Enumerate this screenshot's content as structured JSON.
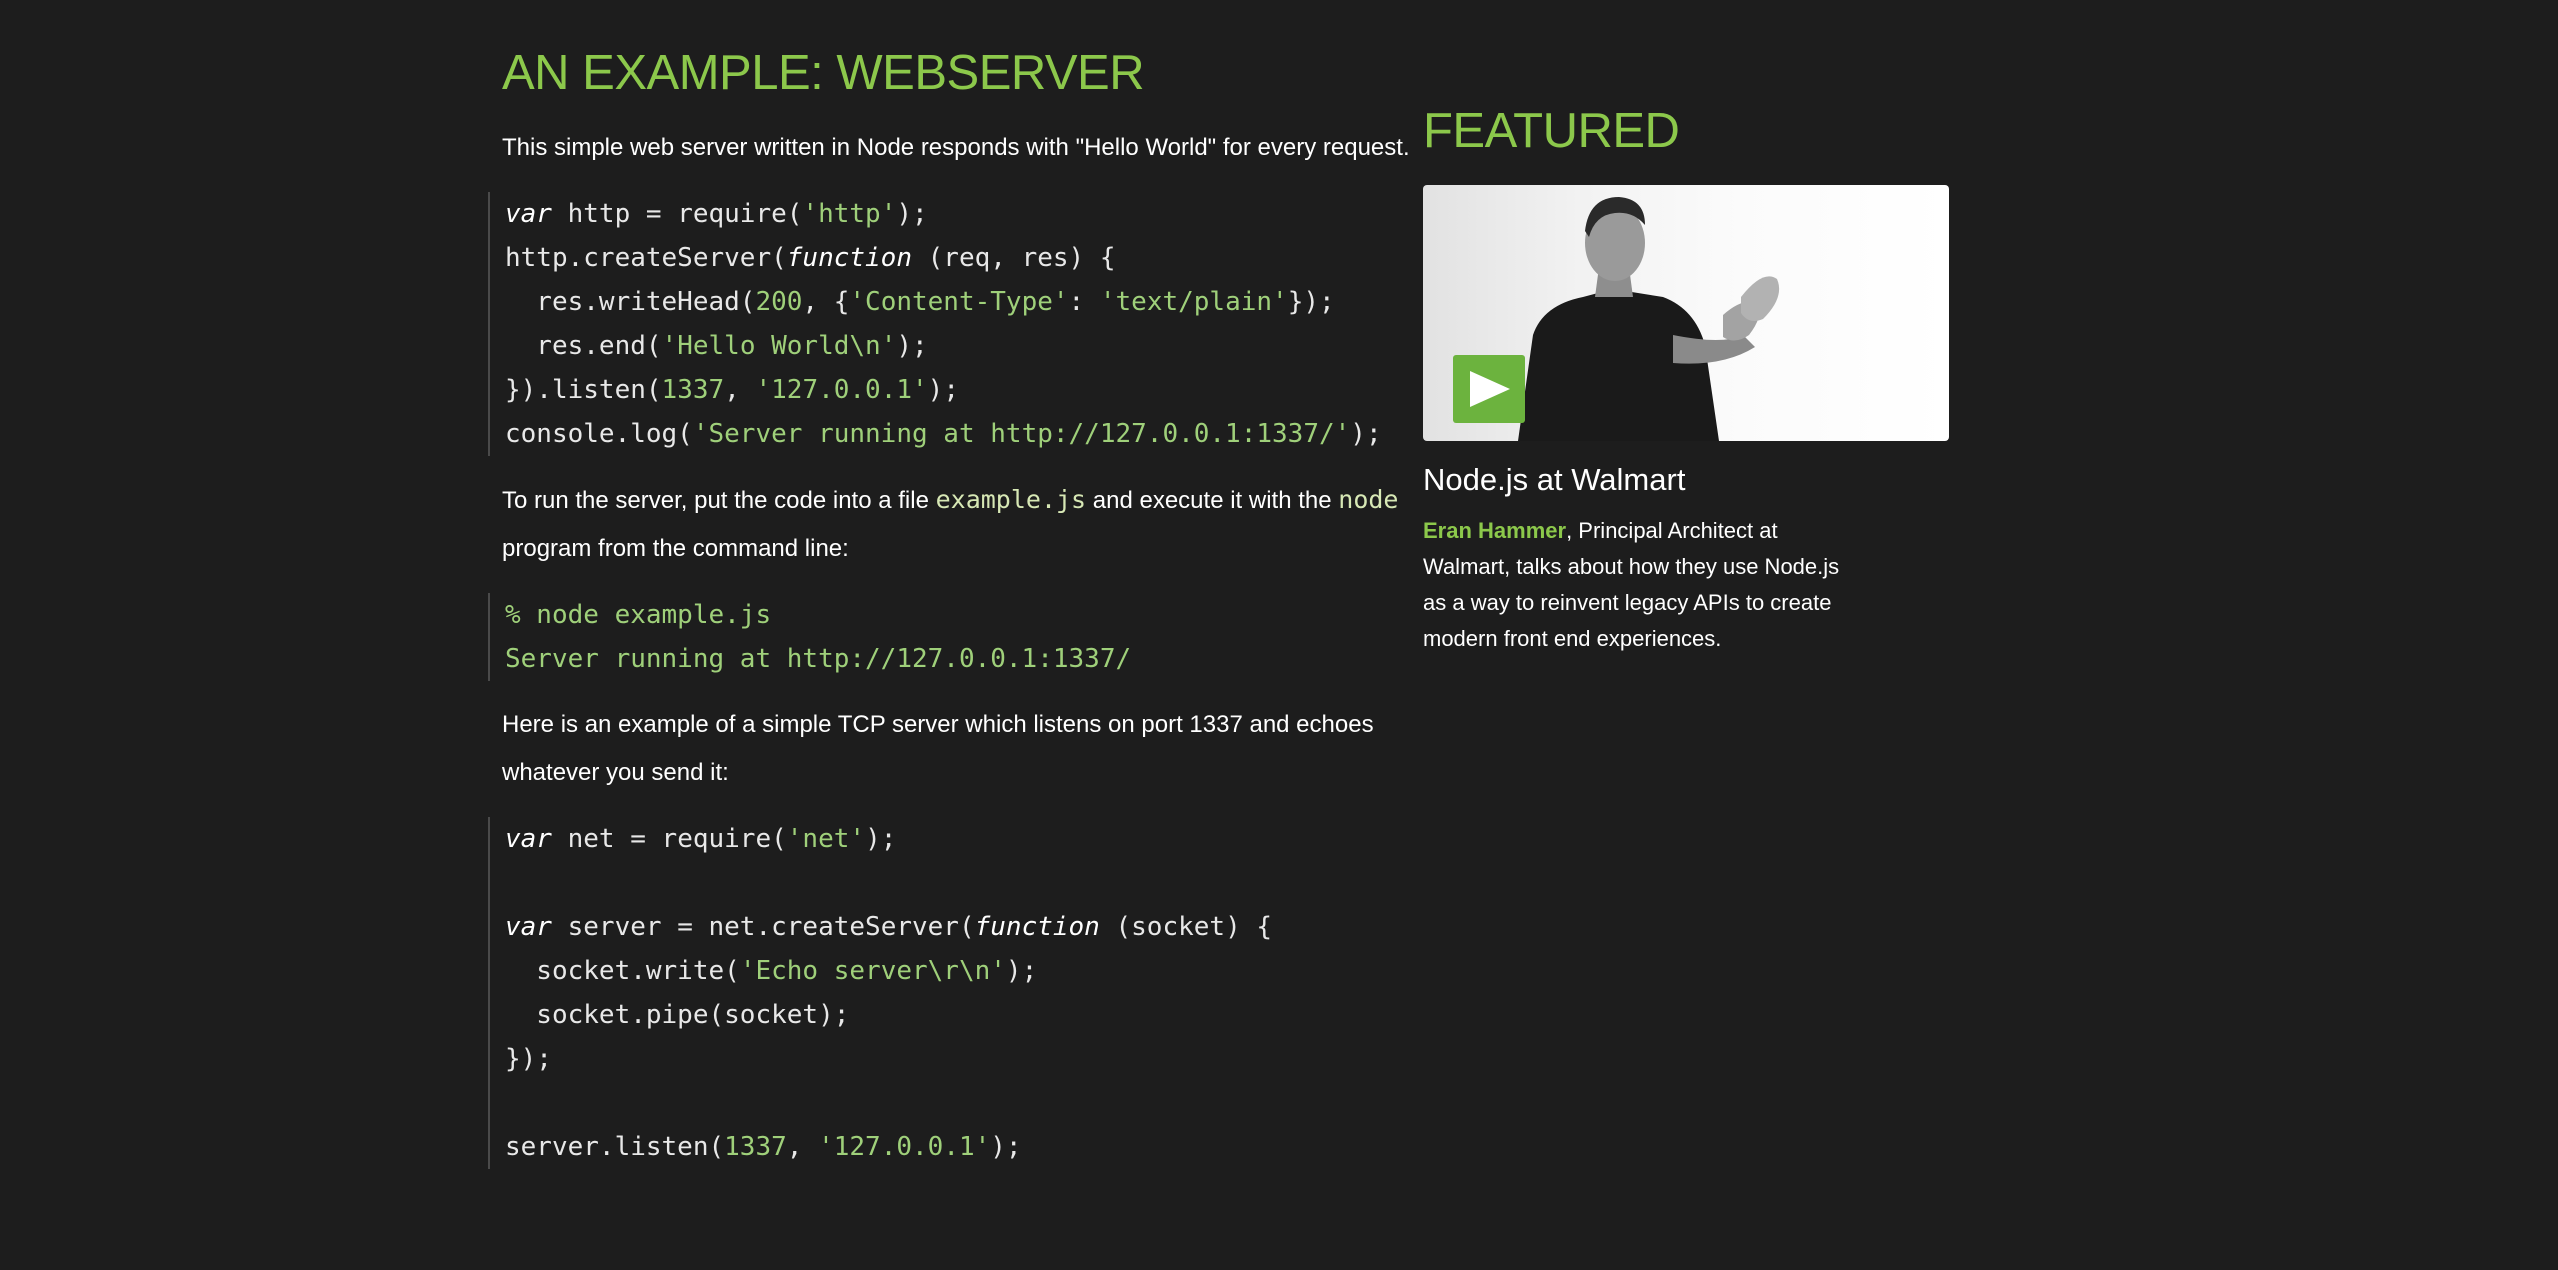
{
  "main": {
    "title": "AN EXAMPLE: WEBSERVER",
    "intro": "This simple web server written in Node responds with \"Hello World\" for every request.",
    "code1": [
      [
        [
          "kw",
          "var"
        ],
        [
          "t",
          " http = require("
        ],
        [
          "str",
          "'http'"
        ],
        [
          "t",
          ");"
        ]
      ],
      [
        [
          "t",
          "http.createServer("
        ],
        [
          "kw",
          "function"
        ],
        [
          "t",
          " (req, res) {"
        ]
      ],
      [
        [
          "t",
          "  res.writeHead("
        ],
        [
          "num",
          "200"
        ],
        [
          "t",
          ", {"
        ],
        [
          "str",
          "'Content-Type'"
        ],
        [
          "t",
          ": "
        ],
        [
          "str",
          "'text/plain'"
        ],
        [
          "t",
          "});"
        ]
      ],
      [
        [
          "t",
          "  res.end("
        ],
        [
          "str",
          "'Hello World\\n'"
        ],
        [
          "t",
          ");"
        ]
      ],
      [
        [
          "t",
          "}).listen("
        ],
        [
          "num",
          "1337"
        ],
        [
          "t",
          ", "
        ],
        [
          "str",
          "'127.0.0.1'"
        ],
        [
          "t",
          ");"
        ]
      ],
      [
        [
          "t",
          "console.log("
        ],
        [
          "str",
          "'Server running at http://127.0.0.1:1337/'"
        ],
        [
          "t",
          ");"
        ]
      ]
    ],
    "run_text_1": "To run the server, put the code into a file ",
    "run_code_file": "example.js",
    "run_text_2": " and execute it with the ",
    "run_code_node": "node",
    "run_text_3": " program from the command line:",
    "code2": [
      [
        [
          "str",
          "% node example.js"
        ]
      ],
      [
        [
          "str",
          "Server running at http://127.0.0.1:1337/"
        ]
      ]
    ],
    "tcp_text": "Here is an example of a simple TCP server which listens on port 1337 and echoes whatever you send it:",
    "code3": [
      [
        [
          "kw",
          "var"
        ],
        [
          "t",
          " net = require("
        ],
        [
          "str",
          "'net'"
        ],
        [
          "t",
          ");"
        ]
      ],
      [
        [
          "t",
          ""
        ]
      ],
      [
        [
          "kw",
          "var"
        ],
        [
          "t",
          " server = net.createServer("
        ],
        [
          "kw",
          "function"
        ],
        [
          "t",
          " (socket) {"
        ]
      ],
      [
        [
          "t",
          "  socket.write("
        ],
        [
          "str",
          "'Echo server\\r\\n'"
        ],
        [
          "t",
          ");"
        ]
      ],
      [
        [
          "t",
          "  socket.pipe(socket);"
        ]
      ],
      [
        [
          "t",
          "});"
        ]
      ],
      [
        [
          "t",
          ""
        ]
      ],
      [
        [
          "t",
          "server.listen("
        ],
        [
          "num",
          "1337"
        ],
        [
          "t",
          ", "
        ],
        [
          "str",
          "'127.0.0.1'"
        ],
        [
          "t",
          ");"
        ]
      ]
    ]
  },
  "sidebar": {
    "heading": "FEATURED",
    "video_title": "Node.js at Walmart",
    "author": "Eran Hammer",
    "description": ", Principal Architect at Walmart, talks about how they use Node.js as a way to reinvent legacy APIs to create modern front end experiences.",
    "play_icon": "play-icon"
  },
  "colors": {
    "accent": "#8cc84b",
    "background": "#1d1d1d",
    "string": "#9fd07a",
    "play_button": "#6cb33e"
  }
}
